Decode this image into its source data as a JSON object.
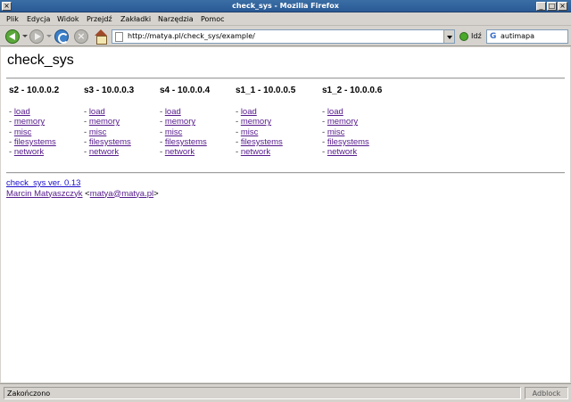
{
  "window": {
    "title": "check_sys - Mozilla Firefox"
  },
  "menu": [
    "Plik",
    "Edycja",
    "Widok",
    "Przejdź",
    "Zakładki",
    "Narzędzia",
    "Pomoc"
  ],
  "toolbar": {
    "url": "http://matya.pl/check_sys/example/",
    "go_label": "Idź",
    "search_value": "autimapa"
  },
  "page": {
    "title": "check_sys",
    "servers": [
      {
        "name": "s2 - 10.0.0.2"
      },
      {
        "name": "s3 - 10.0.0.3"
      },
      {
        "name": "s4 - 10.0.0.4"
      },
      {
        "name": "s1_1 - 10.0.0.5"
      },
      {
        "name": "s1_2 - 10.0.0.6"
      }
    ],
    "links": [
      "load",
      "memory",
      "misc",
      "filesystems",
      "network"
    ],
    "version": "check_sys ver. 0.13",
    "author_name": "Marcin Matyaszczyk",
    "author_email": "matya@matya.pl"
  },
  "status": {
    "text": "Zakończono",
    "addon": "Adblock"
  },
  "icons": [
    "back-icon",
    "forward-icon",
    "reload-icon",
    "stop-icon",
    "home-icon",
    "page-icon",
    "go-icon",
    "google-icon"
  ]
}
